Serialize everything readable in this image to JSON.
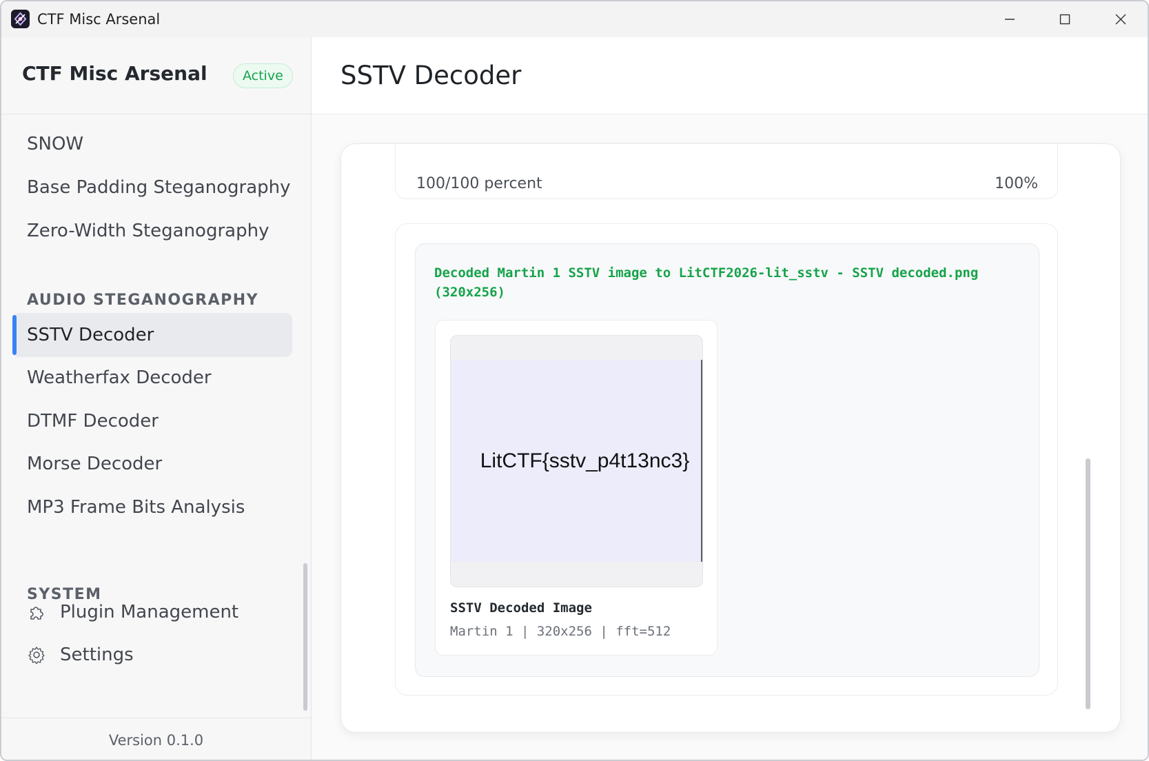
{
  "window": {
    "title": "CTF Misc Arsenal",
    "icon": "app-logo-icon",
    "controls": [
      "minimize-icon",
      "maximize-icon",
      "close-icon"
    ]
  },
  "sidebar": {
    "brand": "CTF Misc Arsenal",
    "status_badge": "Active",
    "items_top": [
      {
        "label": "SNOW"
      },
      {
        "label": "Base Padding Steganography"
      },
      {
        "label": "Zero-Width Steganography"
      }
    ],
    "section_audio": "AUDIO STEGANOGRAPHY",
    "items_audio": [
      {
        "label": "SSTV Decoder",
        "active": true
      },
      {
        "label": "Weatherfax Decoder"
      },
      {
        "label": "DTMF Decoder"
      },
      {
        "label": "Morse Decoder"
      },
      {
        "label": "MP3 Frame Bits Analysis"
      }
    ],
    "section_system": "SYSTEM",
    "items_system": [
      {
        "label": "Plugin Management",
        "icon": "puzzle-icon"
      },
      {
        "label": "Settings",
        "icon": "gear-icon"
      }
    ],
    "version": "Version 0.1.0"
  },
  "main": {
    "page_title": "SSTV Decoder",
    "progress": {
      "label": "100/100 percent",
      "percent_text": "100%",
      "value": 1.0
    },
    "result": {
      "message": "Decoded Martin 1 SSTV image to LitCTF2026-lit_sstv - SSTV decoded.png (320x256)",
      "image_text": "LitCTF{sstv_p4t13nc3}",
      "image_caption": "SSTV Decoded Image",
      "image_meta": "Martin 1 | 320x256 | fft=512"
    }
  },
  "colors": {
    "accent": "#3b82f6",
    "success": "#16a34a",
    "decoded_image_bg": "#ececfb"
  }
}
